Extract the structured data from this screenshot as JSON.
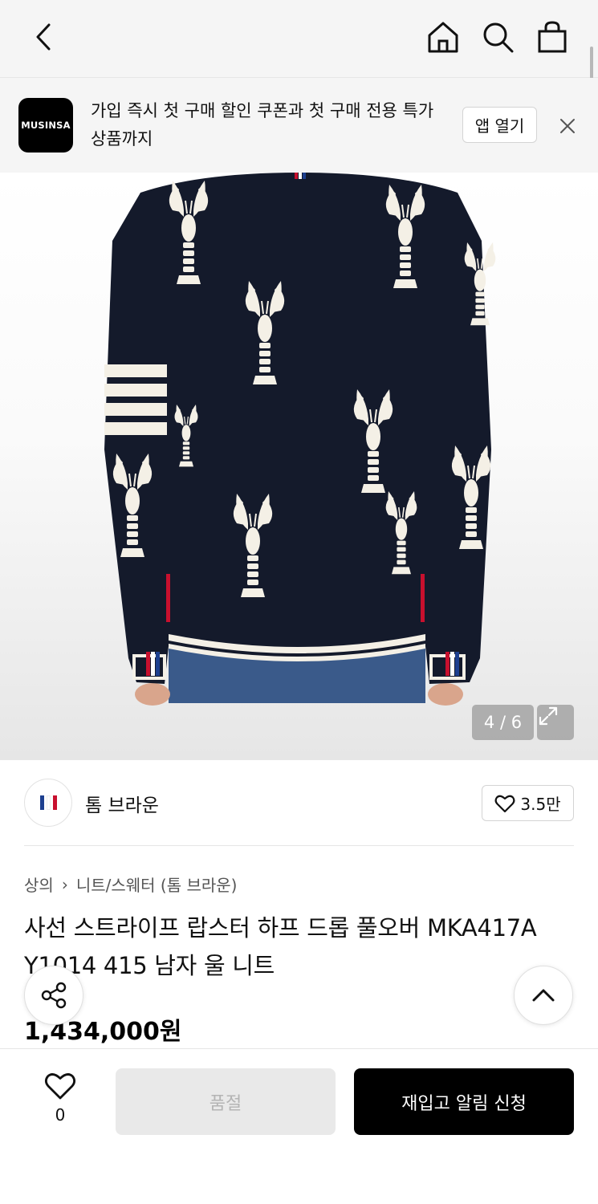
{
  "nav": {
    "back_icon": "chevron-left-icon",
    "home_icon": "home-icon",
    "search_icon": "search-icon",
    "bag_icon": "shopping-bag-icon"
  },
  "promo": {
    "logo_text": "MUSINSA",
    "message": "가입 즉시 첫 구매 할인 쿠폰과 첫 구매 전용 특가 상품까지",
    "open_label": "앱 열기",
    "close_icon": "close-icon"
  },
  "gallery": {
    "counter": "4 / 6",
    "expand_icon": "expand-icon"
  },
  "brand": {
    "name": "톰 브라운",
    "likes": "3.5만",
    "logo_colors": [
      "#1d3f8f",
      "#ffffff",
      "#c8102e"
    ]
  },
  "breadcrumb": {
    "category": "상의",
    "separator": "›",
    "subcategory": "니트/스웨터 (톰 브라운)"
  },
  "product": {
    "title": "사선 스트라이프 랍스터 하프 드롭 풀오버 MKA417A Y1014 415 남자 울 니트",
    "price": "1,434,000원"
  },
  "bottom": {
    "like_count": "0",
    "soldout_label": "품절",
    "restock_label": "재입고 알림 신청"
  },
  "colors": {
    "accent": "#000000",
    "sweater": "#141a2b",
    "stripe": "#f4f0e6"
  }
}
